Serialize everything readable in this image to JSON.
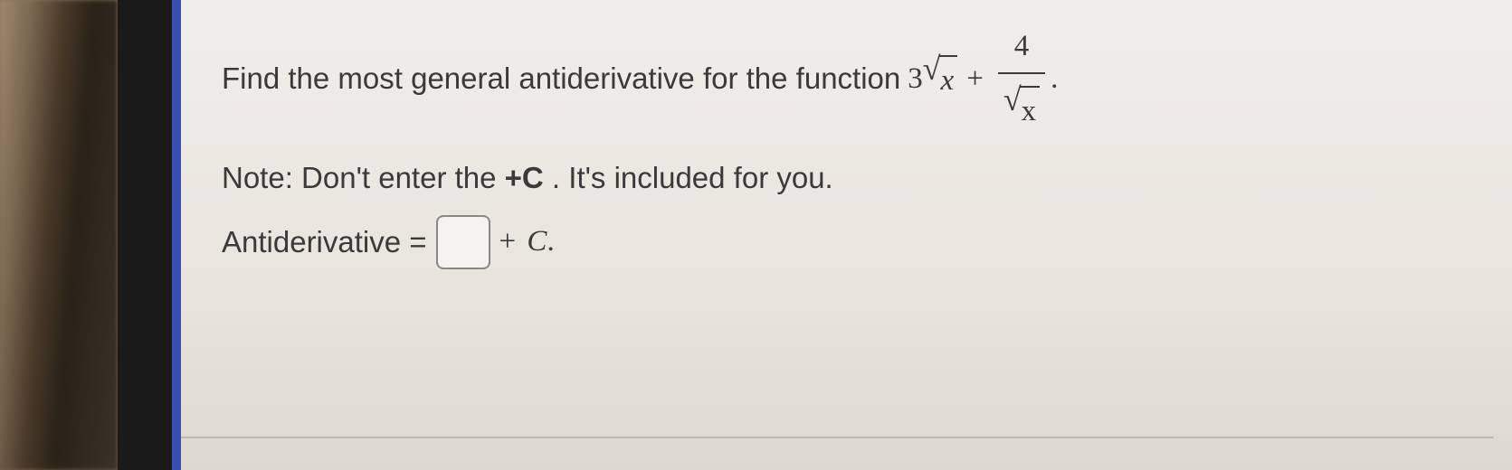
{
  "question": {
    "prompt_text": "Find the most general antiderivative for the function ",
    "expression": {
      "coef1": "3",
      "sqrt_var1": "x",
      "plus": "+",
      "frac_num": "4",
      "frac_den_sqrt": "x",
      "trailing": "."
    }
  },
  "note": {
    "prefix": "Note: Don't enter the ",
    "plus_c": "+C",
    "suffix": " . It's included for you."
  },
  "answer": {
    "label": "Antiderivative = ",
    "input_value": "",
    "suffix_plus": "+ ",
    "suffix_c": "C",
    "suffix_period": "."
  }
}
